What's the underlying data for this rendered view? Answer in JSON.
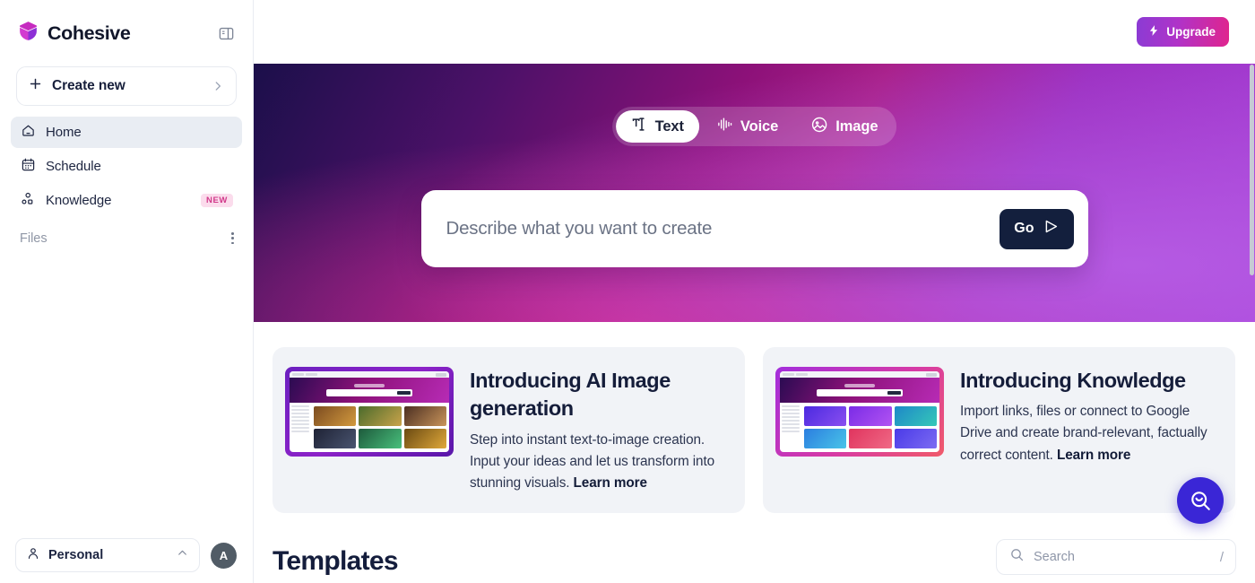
{
  "app": {
    "brand_name": "Cohesive"
  },
  "sidebar": {
    "create_new_label": "Create new",
    "nav": [
      {
        "label": "Home",
        "icon": "home-icon",
        "active": true
      },
      {
        "label": "Schedule",
        "icon": "calendar-icon",
        "active": false
      },
      {
        "label": "Knowledge",
        "icon": "knowledge-icon",
        "badge": "NEW",
        "active": false
      }
    ],
    "files_label": "Files",
    "account": {
      "name": "Personal",
      "avatar_initial": "A"
    }
  },
  "topbar": {
    "upgrade_label": "Upgrade"
  },
  "hero": {
    "tabs": [
      {
        "label": "Text",
        "icon": "text-cursor-icon",
        "active": true
      },
      {
        "label": "Voice",
        "icon": "waveform-icon",
        "active": false
      },
      {
        "label": "Image",
        "icon": "image-icon",
        "active": false
      }
    ],
    "prompt_placeholder": "Describe what you want to create",
    "prompt_value": "",
    "go_label": "Go"
  },
  "promos": [
    {
      "title": "Introducing AI Image generation",
      "text": "Step into instant text-to-image creation. Input your ideas and let us transform into stunning visuals. ",
      "link": "Learn more"
    },
    {
      "title": "Introducing Knowledge",
      "text": "Import links, files or connect to Google Drive and create brand-relevant, factually correct content. ",
      "link": "Learn more"
    }
  ],
  "templates": {
    "title": "Templates",
    "search_placeholder": "Search",
    "search_value": "",
    "slash_hint": "/"
  },
  "colors": {
    "accent_purple": "#8b3bd4",
    "accent_pink": "#e0248d",
    "badge_new_bg": "#fbdcec",
    "badge_new_text": "#d1398a",
    "go_button": "#131f3d",
    "fab": "#3a26d6",
    "nav_active": "#e9edf3"
  }
}
